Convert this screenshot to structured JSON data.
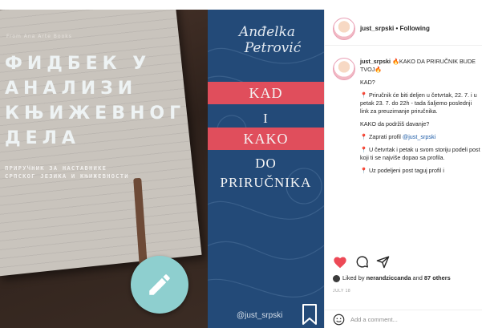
{
  "book": {
    "small_tag": "From Ana Arte Books",
    "title_lines": [
      "ФИДБЕК У",
      "АНАЛИЗИ",
      "КЊИЖЕВНОГ",
      "ДЕЛА"
    ],
    "subtitle_lines": [
      "ПРИРУЧНИК ЗА НАСТАВНИКЕ",
      "СРПСКОГ ЈЕЗИКА И КЊИЖЕВНОСТИ"
    ],
    "fab_icon": "pencil-icon",
    "fab_color": "#8ecfcf"
  },
  "poster": {
    "author_lines": [
      "Anđelka",
      "Petrović"
    ],
    "lines": [
      "KAD",
      "I",
      "KAKO",
      "DO",
      "PRIRUČNIKA"
    ],
    "handle": "@just_srpski",
    "bg_color": "#234a78",
    "accent_color": "#e04e5c"
  },
  "ig": {
    "header_user": "just_srpski",
    "header_following": "• Following",
    "caption_user": "just_srpski",
    "caption_title": "KAKO DA PRIRUČNIK BUDE TVOJ",
    "caption_lines": [
      "KAD?",
      "Priručnik će biti deljen u četvrtak, 22. 7. i u petak 23. 7. do 22h - tada šaljemo poslednji link za preuzimanje priručnika.",
      "KAKO da podržiš davanje?",
      "Zaprati profil",
      "U četvrtak i petak u svom storiju podeli post koji ti se najviše dopao sa profila.",
      "Uz podeljeni post taguj profil i"
    ],
    "profile_link": "@just_srpski",
    "likes_prefix": "Liked by",
    "likes_user": "nerandziccanda",
    "likes_mid": "and",
    "likes_others": "87 others",
    "date": "JULY 18",
    "comment_placeholder": "Add a comment..."
  }
}
